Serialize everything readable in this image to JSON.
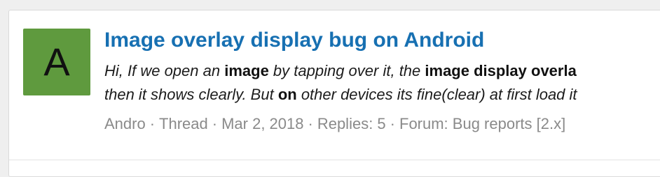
{
  "result": {
    "avatar": {
      "letter": "A",
      "color": "#5f9a3e"
    },
    "title": "Image overlay display bug on Android",
    "title_color": "#1770b2",
    "snippet": {
      "line1": [
        {
          "text": "Hi, If we open an ",
          "bold": false
        },
        {
          "text": "image",
          "bold": true
        },
        {
          "text": " by tapping over it, the ",
          "bold": false
        },
        {
          "text": "image display overla",
          "bold": true
        }
      ],
      "line2": [
        {
          "text": "then it shows clearly. But ",
          "bold": false
        },
        {
          "text": "on",
          "bold": true
        },
        {
          "text": " other devices its fine(clear) at first load it",
          "bold": false
        }
      ]
    },
    "meta": {
      "author": "Andro",
      "type": "Thread",
      "date": "Mar 2, 2018",
      "replies": "Replies: 5",
      "forum": "Forum: Bug reports [2.x]",
      "separator": "·"
    }
  }
}
